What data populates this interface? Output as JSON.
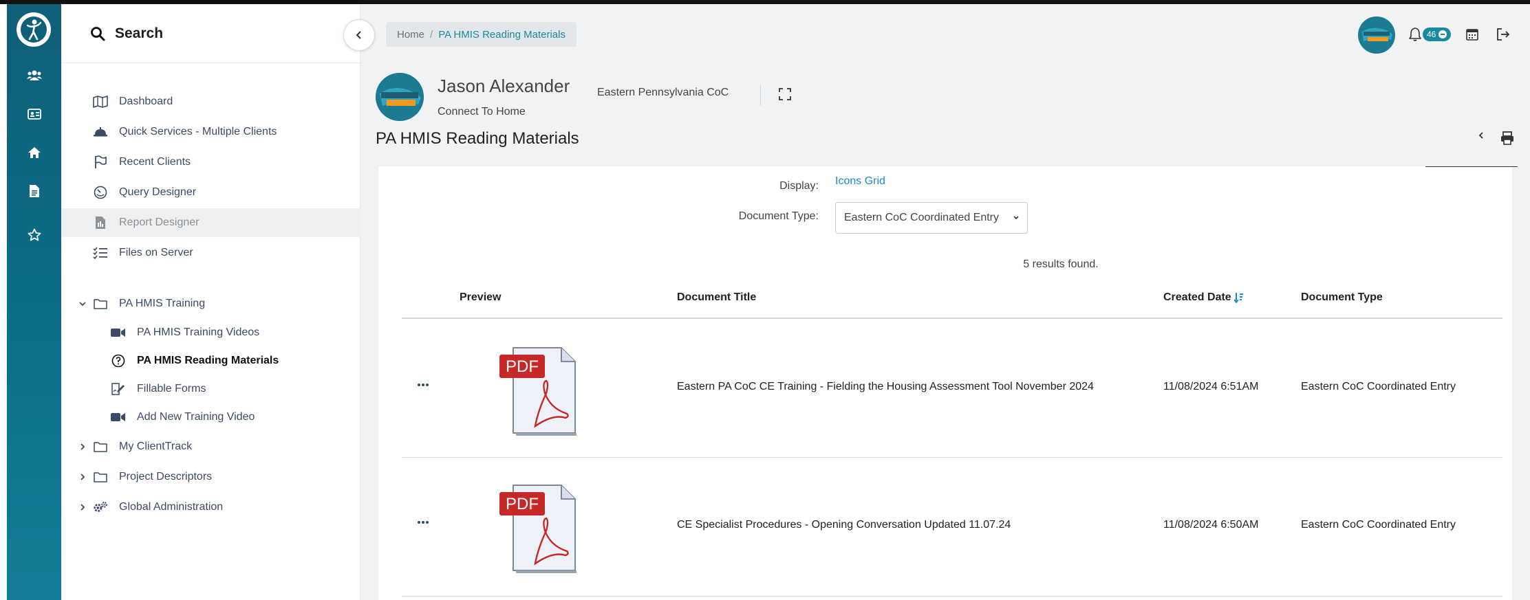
{
  "rail": {
    "icons": [
      "app-logo",
      "users-icon",
      "id-card-icon",
      "home-icon",
      "document-icon",
      "star-icon"
    ]
  },
  "sidebar": {
    "search_label": "Search",
    "items": [
      {
        "label": "Dashboard",
        "icon": "map-icon"
      },
      {
        "label": "Quick Services - Multiple Clients",
        "icon": "bell-service-icon"
      },
      {
        "label": "Recent Clients",
        "icon": "flag-icon"
      },
      {
        "label": "Query Designer",
        "icon": "gauge-icon"
      },
      {
        "label": "Report Designer",
        "icon": "report-icon"
      },
      {
        "label": "Files on Server",
        "icon": "list-check-icon"
      }
    ],
    "folders": [
      {
        "label": "PA HMIS Training",
        "expanded": true,
        "children": [
          {
            "label": "PA HMIS Training Videos",
            "icon": "video-icon"
          },
          {
            "label": "PA HMIS Reading Materials",
            "icon": "question-circle-icon"
          },
          {
            "label": "Fillable Forms",
            "icon": "form-edit-icon"
          },
          {
            "label": "Add New Training Video",
            "icon": "video-icon"
          }
        ]
      },
      {
        "label": "My ClientTrack",
        "expanded": false
      },
      {
        "label": "Project Descriptors",
        "expanded": false
      },
      {
        "label": "Global Administration",
        "expanded": false
      }
    ]
  },
  "header": {
    "breadcrumb": {
      "home": "Home",
      "separator": "/",
      "current": "PA HMIS Reading Materials"
    },
    "notification_count": "46",
    "avatar_text_top": "HOMELESSNESS",
    "avatar_text_bottom": "SOLVABLE"
  },
  "client": {
    "name": "Jason Alexander",
    "status": "Connect To Home",
    "org": "Eastern Pennsylvania CoC",
    "avatar_line1": "HOMELESSNESS",
    "avatar_line2": "IS",
    "avatar_line3": "SOLVABLE"
  },
  "page": {
    "title": "PA HMIS Reading Materials",
    "display_label": "Display:",
    "display_value": "Icons Grid",
    "doctype_label": "Document Type:",
    "doctype_value": "Eastern CoC Coordinated Entry",
    "results": "5 results found.",
    "columns": {
      "preview": "Preview",
      "title": "Document Title",
      "created": "Created Date",
      "type": "Document Type"
    },
    "rows": [
      {
        "pdf_label": "PDF",
        "title": "Eastern PA CoC CE Training - Fielding the Housing Assessment Tool November 2024",
        "date": "11/08/2024 6:51AM",
        "type": "Eastern CoC Coordinated Entry"
      },
      {
        "pdf_label": "PDF",
        "title": "CE Specialist Procedures - Opening Conversation Updated 11.07.24",
        "date": "11/08/2024 6:50AM",
        "type": "Eastern CoC Coordinated Entry"
      }
    ]
  },
  "colors": {
    "rail": "#0f5f78",
    "accent": "#1a8aa0",
    "link": "#1a8ad0",
    "pdf_red": "#c62828"
  }
}
